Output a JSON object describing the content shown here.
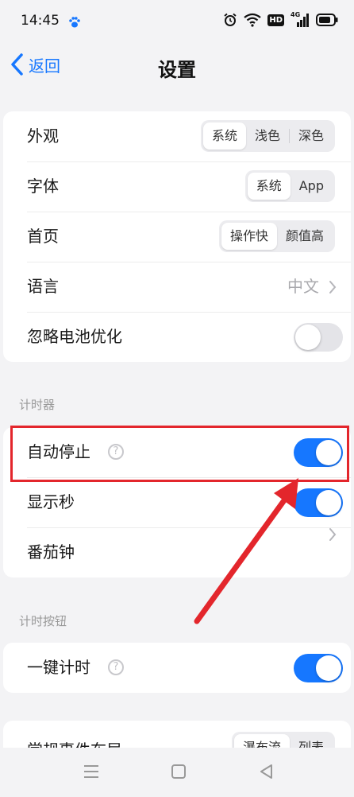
{
  "status_bar": {
    "time": "14:45",
    "icons": [
      "paw-icon",
      "alarm-icon",
      "wifi-icon",
      "hd-icon",
      "signal-4g-icon",
      "battery-icon"
    ],
    "hd_label": "HD",
    "network_label": "4G"
  },
  "nav": {
    "back_label": "返回",
    "title": "设置"
  },
  "general": {
    "appearance": {
      "label": "外观",
      "options": [
        "系统",
        "浅色",
        "深色"
      ],
      "selected": "系统"
    },
    "font": {
      "label": "字体",
      "options": [
        "系统",
        "App"
      ],
      "selected": "系统"
    },
    "home": {
      "label": "首页",
      "options": [
        "操作快",
        "颜值高"
      ],
      "selected": "操作快"
    },
    "language": {
      "label": "语言",
      "value": "中文"
    },
    "ignore_battery": {
      "label": "忽略电池优化",
      "enabled": false
    }
  },
  "timer_section": {
    "header": "计时器",
    "auto_stop": {
      "label": "自动停止",
      "enabled": true
    },
    "show_seconds": {
      "label": "显示秒",
      "enabled": true
    },
    "pomodoro": {
      "label": "番茄钟"
    }
  },
  "timer_button_section": {
    "header": "计时按钮",
    "one_tap": {
      "label": "一键计时",
      "enabled": true
    }
  },
  "layout_section": {
    "common_event_layout": {
      "label": "常规事件布局",
      "options": [
        "瀑布流",
        "列表"
      ],
      "selected": "瀑布流"
    }
  },
  "colors": {
    "accent": "#1677ff",
    "annotation": "#e3262c"
  }
}
